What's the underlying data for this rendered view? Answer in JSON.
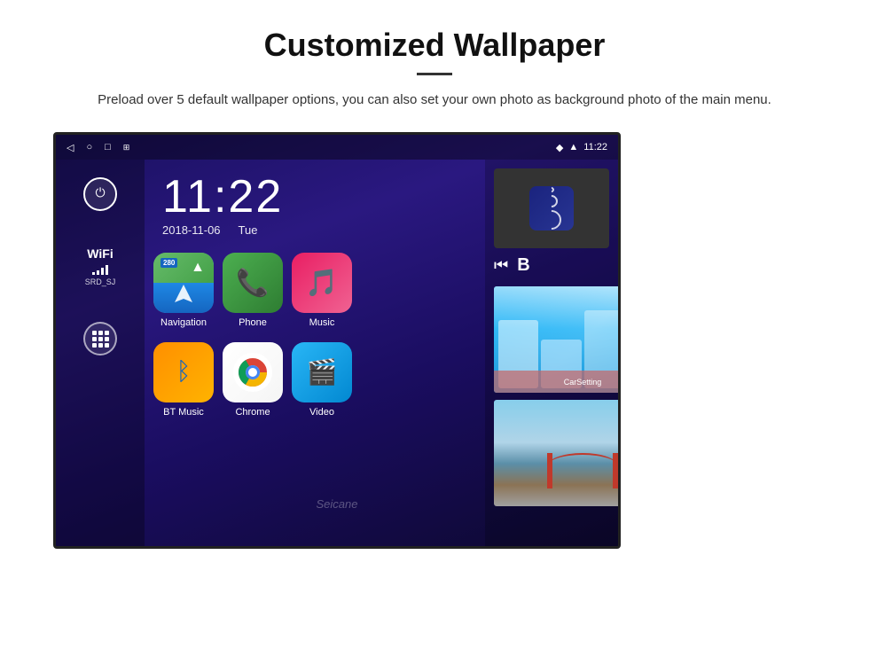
{
  "page": {
    "title": "Customized Wallpaper",
    "divider": true,
    "description": "Preload over 5 default wallpaper options, you can also set your own photo as background photo of the main menu."
  },
  "android": {
    "statusBar": {
      "time": "11:22",
      "icons": [
        "back",
        "home",
        "recents",
        "screenshot"
      ],
      "rightIcons": [
        "location",
        "wifi",
        "time"
      ]
    },
    "clock": {
      "time": "11:22",
      "date": "2018-11-06",
      "day": "Tue"
    },
    "wifi": {
      "label": "WiFi",
      "network": "SRD_SJ",
      "bars": 4
    },
    "apps": [
      {
        "name": "Navigation",
        "type": "navigation",
        "badge": "280"
      },
      {
        "name": "Phone",
        "type": "phone"
      },
      {
        "name": "Music",
        "type": "music"
      },
      {
        "name": "BT Music",
        "type": "bt-music"
      },
      {
        "name": "Chrome",
        "type": "chrome"
      },
      {
        "name": "Video",
        "type": "video"
      },
      {
        "name": "CarSetting",
        "type": "car-setting"
      }
    ],
    "mediaControls": {
      "prevLabel": "⏮",
      "nextLabel": "B"
    }
  },
  "wallpapers": [
    {
      "name": "ice-cave",
      "type": "ice"
    },
    {
      "name": "golden-gate",
      "type": "bridge"
    }
  ],
  "watermark": "Seicane"
}
